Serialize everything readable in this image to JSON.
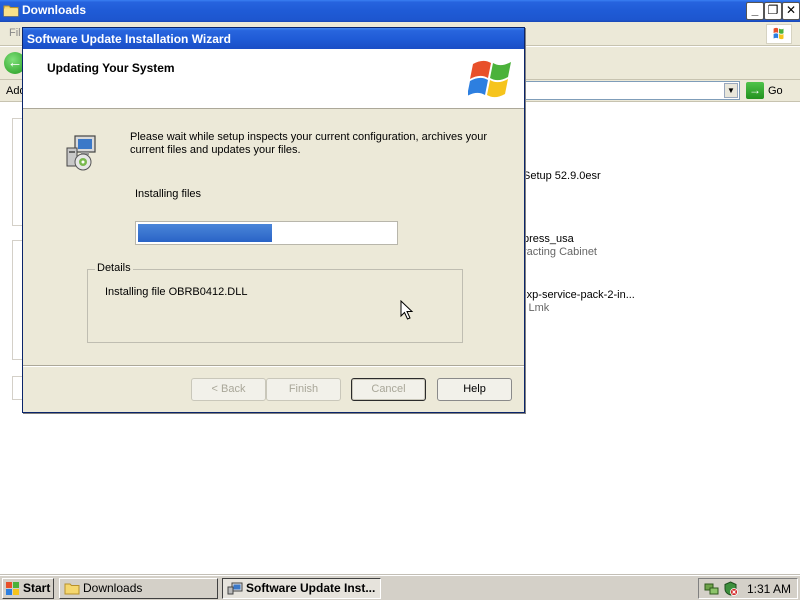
{
  "explorer": {
    "title": "Downloads",
    "menu_file_fragment": "Fil",
    "address_label_fragment": "Add",
    "go_label": "Go",
    "files": [
      {
        "name": "Setup 52.9.0esr",
        "sub": ""
      },
      {
        "name": "press_usa",
        "sub": "racting Cabinet"
      },
      {
        "name": "-xp-service-pack-2-in...",
        "sub": "l Lmk"
      }
    ]
  },
  "wizard": {
    "title": "Software Update Installation Wizard",
    "header_title": "Updating Your System",
    "description": "Please wait while setup inspects your current configuration, archives your current files and updates your files.",
    "status_label": "Installing files",
    "progress": 0.52,
    "details_legend": "Details",
    "details_text": "Installing file OBRB0412.DLL",
    "buttons": {
      "back": "< Back",
      "finish": "Finish",
      "cancel": "Cancel",
      "help": "Help"
    }
  },
  "taskbar": {
    "start_label": "Start",
    "tasks": [
      {
        "label": "Downloads",
        "icon": "folder-icon",
        "active": false
      },
      {
        "label": "Software Update Inst...",
        "icon": "installer-icon",
        "active": true
      }
    ],
    "tray_icons": [
      "network-icon",
      "security-alert-icon"
    ],
    "clock": "1:31 AM"
  },
  "colors": {
    "titlebar_blue": "#1f5bd6",
    "progress_blue": "#2a63c6",
    "dialog_face": "#ece9d8"
  }
}
